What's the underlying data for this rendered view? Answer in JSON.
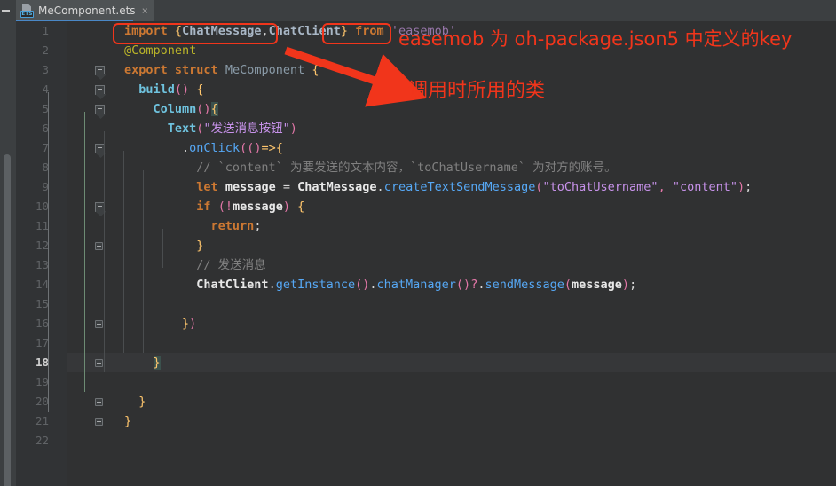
{
  "window": {
    "minimize_glyph": "—"
  },
  "tab": {
    "title": "MeComponent.ets",
    "close_glyph": "×",
    "icon_badge": "ETS",
    "icon_name": "ets-file-icon"
  },
  "editor": {
    "current_line": 18,
    "background": "#303132",
    "gutter_background": "#313335",
    "lines": [
      {
        "n": 1,
        "html": "<span class=\"kw\">import</span> <span class=\"brc\">{</span><span class=\"cls\">ChatMessage</span><span class=\"plain\">,</span><span class=\"cls\">ChatClient</span><span class=\"brc\">}</span> <span class=\"kw\">from</span> <span class=\"strp\">'easemob'</span>",
        "text": "import {ChatMessage,ChatClient} from 'easemob'"
      },
      {
        "n": 2,
        "html": "<span class=\"anno\">@Component</span>",
        "text": "@Component"
      },
      {
        "n": 3,
        "html": "<span class=\"kw\">export struct</span> <span class=\"type\">MeComponent</span> <span class=\"brc\">{</span>",
        "text": "export struct MeComponent {"
      },
      {
        "n": 4,
        "html": "  <span class=\"fn\">build</span><span class=\"par\">()</span> <span class=\"brc\">{</span>",
        "text": "  build() {"
      },
      {
        "n": 5,
        "html": "    <span class=\"fn\">Column</span><span class=\"par\">()</span><span class=\"brc hl\">{</span>",
        "text": "    Column(){"
      },
      {
        "n": 6,
        "html": "      <span class=\"txtfn\">Text</span><span class=\"par\">(</span><span class=\"strc\">\"发送消息按钮\"</span><span class=\"par\">)</span>",
        "text": "      Text(\"发送消息按钮\")"
      },
      {
        "n": 7,
        "html": "        <span class=\"plain\">.</span><span class=\"mth\">onClick</span><span class=\"par\">((</span><span class=\"par\">)</span><span class=\"brc\">=&gt;{</span>",
        "text": "        .onClick(()=>{"
      },
      {
        "n": 8,
        "html": "          <span class=\"cmt\">// `content` 为要发送的文本内容，`toChatUsername` 为对方的账号。</span>",
        "text": "          // `content` 为要发送的文本内容，`toChatUsername` 为对方的账号。"
      },
      {
        "n": 9,
        "html": "          <span class=\"kw\">let</span> <span class=\"wht\">message</span> <span class=\"plain\">=</span> <span class=\"wht\">ChatMessage</span><span class=\"plain\">.</span><span class=\"mth\">createTextSendMessage</span><span class=\"par\">(</span><span class=\"strc\">\"toChatUsername\"</span><span class=\"par\">,</span> <span class=\"strc\">\"content\"</span><span class=\"par\">)</span><span class=\"plain\">;</span>",
        "text": "          let message = ChatMessage.createTextSendMessage(\"toChatUsername\", \"content\");"
      },
      {
        "n": 10,
        "html": "          <span class=\"kw\">if</span> <span class=\"par\">(!</span><span class=\"wht\">message</span><span class=\"par\">)</span> <span class=\"brc\">{</span>",
        "text": "          if (!message) {"
      },
      {
        "n": 11,
        "html": "            <span class=\"kw\">return</span><span class=\"plain\">;</span>",
        "text": "            return;"
      },
      {
        "n": 12,
        "html": "          <span class=\"brc\">}</span>",
        "text": "          }"
      },
      {
        "n": 13,
        "html": "          <span class=\"cmt\">// 发送消息</span>",
        "text": "          // 发送消息"
      },
      {
        "n": 14,
        "html": "          <span class=\"wht\">ChatClient</span><span class=\"plain\">.</span><span class=\"mth\">getInstance</span><span class=\"par\">()</span><span class=\"plain\">.</span><span class=\"mth\">chatManager</span><span class=\"par\">()</span><span class=\"par\">?</span><span class=\"plain\">.</span><span class=\"mth\">sendMessage</span><span class=\"par\">(</span><span class=\"wht\">message</span><span class=\"par\">)</span><span class=\"plain\">;</span>",
        "text": "          ChatClient.getInstance().chatManager()?.sendMessage(message);"
      },
      {
        "n": 15,
        "html": "",
        "text": ""
      },
      {
        "n": 16,
        "html": "        <span class=\"brc\">}</span><span class=\"par\">)</span>",
        "text": "        })"
      },
      {
        "n": 17,
        "html": "",
        "text": ""
      },
      {
        "n": 18,
        "html": "    <span class=\"brc hl\">}</span>",
        "text": "    }"
      },
      {
        "n": 19,
        "html": "",
        "text": ""
      },
      {
        "n": 20,
        "html": "  <span class=\"brc\">}</span>",
        "text": "  }"
      },
      {
        "n": 21,
        "html": "<span class=\"brc\">}</span>",
        "text": "}"
      },
      {
        "n": 22,
        "html": "",
        "text": ""
      }
    ]
  },
  "annotations": {
    "color": "#f1351b",
    "box_import_label": "{ChatMessage,ChatClient}",
    "box_module_label": "'easemob'",
    "note_module": "easemob 为 oh-package.json5 中定义的key",
    "note_classes": "调用时所用的类"
  }
}
